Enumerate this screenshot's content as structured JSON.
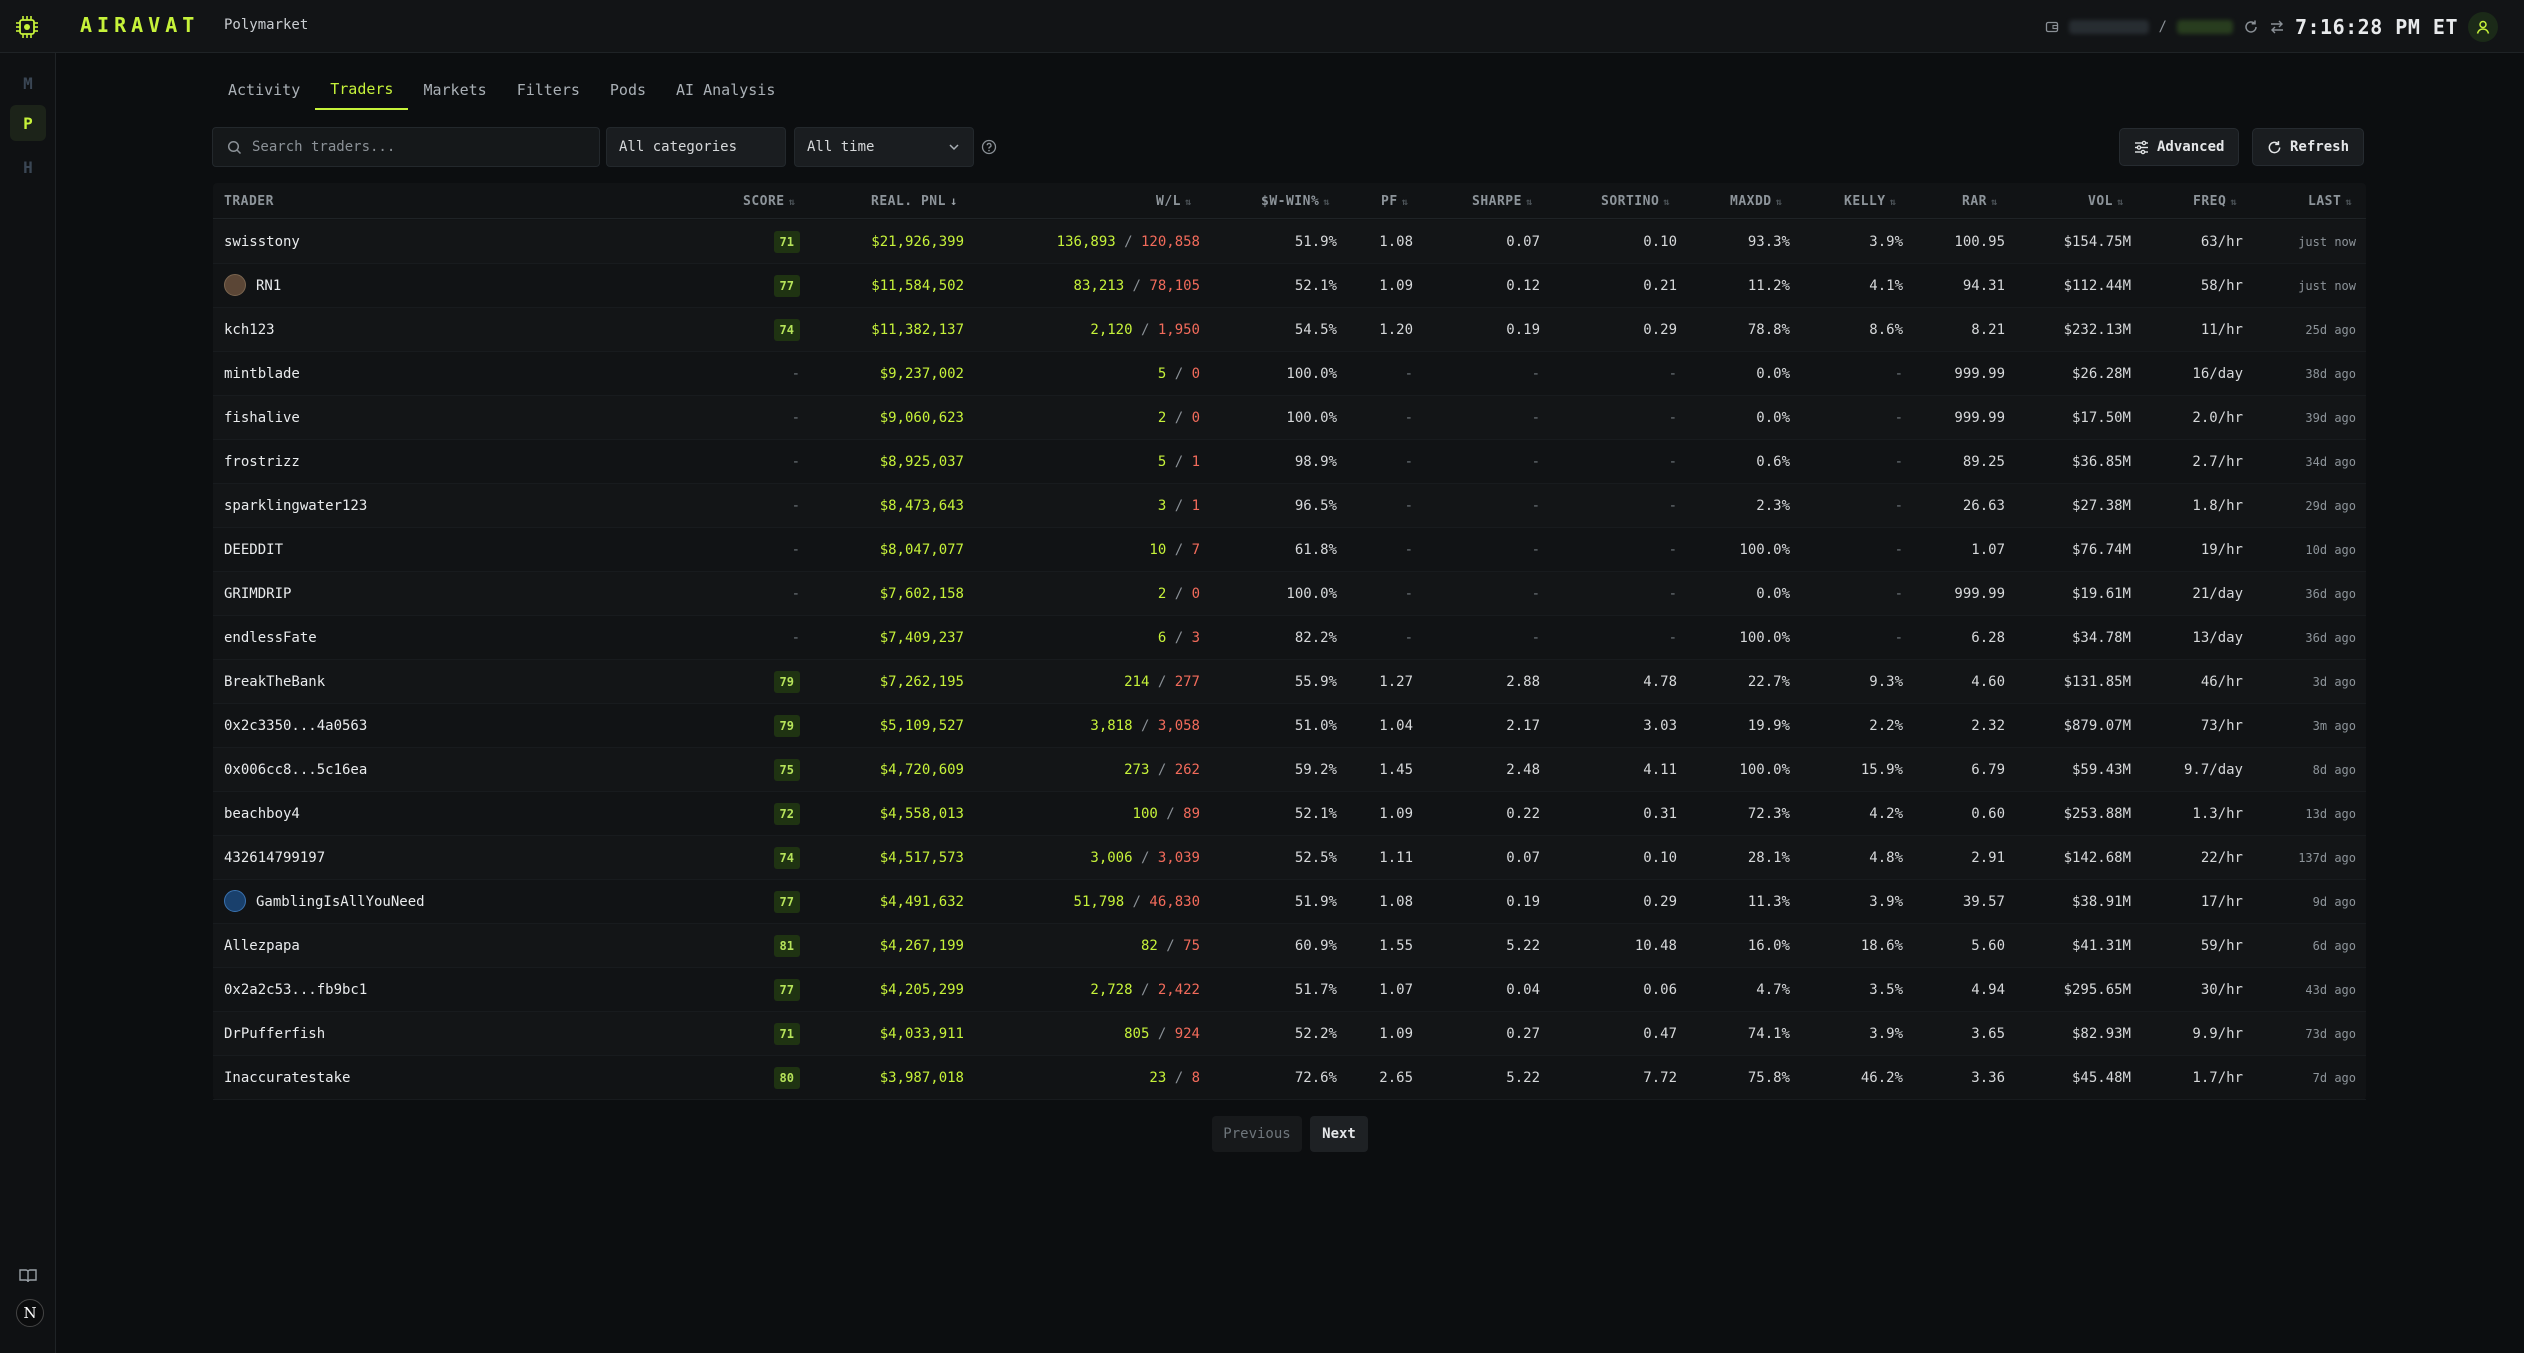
{
  "app": {
    "brand": "AIRAVAT",
    "platform": "Polymarket",
    "clock": "7:16:28 PM ET",
    "accent": "#c6f23a"
  },
  "sidebar": {
    "items": [
      "M",
      "P",
      "H"
    ],
    "active": "P",
    "footer_logo": "N"
  },
  "tabs": [
    {
      "label": "Activity"
    },
    {
      "label": "Traders",
      "active": true
    },
    {
      "label": "Markets"
    },
    {
      "label": "Filters"
    },
    {
      "label": "Pods"
    },
    {
      "label": "AI Analysis"
    }
  ],
  "filters": {
    "search_placeholder": "Search traders...",
    "category": "All categories",
    "timeframe": "All time",
    "advanced_label": "Advanced",
    "refresh_label": "Refresh"
  },
  "table": {
    "columns": [
      "TRADER",
      "SCORE",
      "REAL. PNL",
      "W/L",
      "$W-WIN%",
      "PF",
      "SHARPE",
      "SORTINO",
      "MAXDD",
      "KELLY",
      "RAR",
      "VOL",
      "FREQ",
      "LAST"
    ],
    "sorted_by": "REAL. PNL",
    "rows": [
      {
        "trader": "swisstony",
        "score": "71",
        "pnl": "$21,926,399",
        "wins": "136,893",
        "losses": "120,858",
        "wwin": "51.9%",
        "pf": "1.08",
        "sharpe": "0.07",
        "sortino": "0.10",
        "maxdd": "93.3%",
        "kelly": "3.9%",
        "rar": "100.95",
        "vol": "$154.75M",
        "freq": "63/hr",
        "last": "just now"
      },
      {
        "trader": "RN1",
        "avatar": "brown",
        "score": "77",
        "pnl": "$11,584,502",
        "wins": "83,213",
        "losses": "78,105",
        "wwin": "52.1%",
        "pf": "1.09",
        "sharpe": "0.12",
        "sortino": "0.21",
        "maxdd": "11.2%",
        "kelly": "4.1%",
        "rar": "94.31",
        "vol": "$112.44M",
        "freq": "58/hr",
        "last": "just now"
      },
      {
        "trader": "kch123",
        "score": "74",
        "pnl": "$11,382,137",
        "wins": "2,120",
        "losses": "1,950",
        "wwin": "54.5%",
        "pf": "1.20",
        "sharpe": "0.19",
        "sortino": "0.29",
        "maxdd": "78.8%",
        "kelly": "8.6%",
        "rar": "8.21",
        "vol": "$232.13M",
        "freq": "11/hr",
        "last": "25d ago"
      },
      {
        "trader": "mintblade",
        "score": "-",
        "pnl": "$9,237,002",
        "wins": "5",
        "losses": "0",
        "wwin": "100.0%",
        "pf": "-",
        "sharpe": "-",
        "sortino": "-",
        "maxdd": "0.0%",
        "kelly": "-",
        "rar": "999.99",
        "vol": "$26.28M",
        "freq": "16/day",
        "last": "38d ago"
      },
      {
        "trader": "fishalive",
        "score": "-",
        "pnl": "$9,060,623",
        "wins": "2",
        "losses": "0",
        "wwin": "100.0%",
        "pf": "-",
        "sharpe": "-",
        "sortino": "-",
        "maxdd": "0.0%",
        "kelly": "-",
        "rar": "999.99",
        "vol": "$17.50M",
        "freq": "2.0/hr",
        "last": "39d ago"
      },
      {
        "trader": "frostrizz",
        "score": "-",
        "pnl": "$8,925,037",
        "wins": "5",
        "losses": "1",
        "wwin": "98.9%",
        "pf": "-",
        "sharpe": "-",
        "sortino": "-",
        "maxdd": "0.6%",
        "kelly": "-",
        "rar": "89.25",
        "vol": "$36.85M",
        "freq": "2.7/hr",
        "last": "34d ago"
      },
      {
        "trader": "sparklingwater123",
        "score": "-",
        "pnl": "$8,473,643",
        "wins": "3",
        "losses": "1",
        "wwin": "96.5%",
        "pf": "-",
        "sharpe": "-",
        "sortino": "-",
        "maxdd": "2.3%",
        "kelly": "-",
        "rar": "26.63",
        "vol": "$27.38M",
        "freq": "1.8/hr",
        "last": "29d ago"
      },
      {
        "trader": "DEEDDIT",
        "score": "-",
        "pnl": "$8,047,077",
        "wins": "10",
        "losses": "7",
        "wwin": "61.8%",
        "pf": "-",
        "sharpe": "-",
        "sortino": "-",
        "maxdd": "100.0%",
        "kelly": "-",
        "rar": "1.07",
        "vol": "$76.74M",
        "freq": "19/hr",
        "last": "10d ago"
      },
      {
        "trader": "GRIMDRIP",
        "score": "-",
        "pnl": "$7,602,158",
        "wins": "2",
        "losses": "0",
        "wwin": "100.0%",
        "pf": "-",
        "sharpe": "-",
        "sortino": "-",
        "maxdd": "0.0%",
        "kelly": "-",
        "rar": "999.99",
        "vol": "$19.61M",
        "freq": "21/day",
        "last": "36d ago"
      },
      {
        "trader": "endlessFate",
        "score": "-",
        "pnl": "$7,409,237",
        "wins": "6",
        "losses": "3",
        "wwin": "82.2%",
        "pf": "-",
        "sharpe": "-",
        "sortino": "-",
        "maxdd": "100.0%",
        "kelly": "-",
        "rar": "6.28",
        "vol": "$34.78M",
        "freq": "13/day",
        "last": "36d ago"
      },
      {
        "trader": "BreakTheBank",
        "score": "79",
        "pnl": "$7,262,195",
        "wins": "214",
        "losses": "277",
        "wwin": "55.9%",
        "pf": "1.27",
        "sharpe": "2.88",
        "sortino": "4.78",
        "maxdd": "22.7%",
        "kelly": "9.3%",
        "rar": "4.60",
        "vol": "$131.85M",
        "freq": "46/hr",
        "last": "3d ago"
      },
      {
        "trader": "0x2c3350...4a0563",
        "score": "79",
        "pnl": "$5,109,527",
        "wins": "3,818",
        "losses": "3,058",
        "wwin": "51.0%",
        "pf": "1.04",
        "sharpe": "2.17",
        "sortino": "3.03",
        "maxdd": "19.9%",
        "kelly": "2.2%",
        "rar": "2.32",
        "vol": "$879.07M",
        "freq": "73/hr",
        "last": "3m ago"
      },
      {
        "trader": "0x006cc8...5c16ea",
        "score": "75",
        "pnl": "$4,720,609",
        "wins": "273",
        "losses": "262",
        "wwin": "59.2%",
        "pf": "1.45",
        "sharpe": "2.48",
        "sortino": "4.11",
        "maxdd": "100.0%",
        "kelly": "15.9%",
        "rar": "6.79",
        "vol": "$59.43M",
        "freq": "9.7/day",
        "last": "8d ago"
      },
      {
        "trader": "beachboy4",
        "score": "72",
        "pnl": "$4,558,013",
        "wins": "100",
        "losses": "89",
        "wwin": "52.1%",
        "pf": "1.09",
        "sharpe": "0.22",
        "sortino": "0.31",
        "maxdd": "72.3%",
        "kelly": "4.2%",
        "rar": "0.60",
        "vol": "$253.88M",
        "freq": "1.3/hr",
        "last": "13d ago"
      },
      {
        "trader": "432614799197",
        "score": "74",
        "pnl": "$4,517,573",
        "wins": "3,006",
        "losses": "3,039",
        "wwin": "52.5%",
        "pf": "1.11",
        "sharpe": "0.07",
        "sortino": "0.10",
        "maxdd": "28.1%",
        "kelly": "4.8%",
        "rar": "2.91",
        "vol": "$142.68M",
        "freq": "22/hr",
        "last": "137d ago"
      },
      {
        "trader": "GamblingIsAllYouNeed",
        "avatar": "blue",
        "score": "77",
        "pnl": "$4,491,632",
        "wins": "51,798",
        "losses": "46,830",
        "wwin": "51.9%",
        "pf": "1.08",
        "sharpe": "0.19",
        "sortino": "0.29",
        "maxdd": "11.3%",
        "kelly": "3.9%",
        "rar": "39.57",
        "vol": "$38.91M",
        "freq": "17/hr",
        "last": "9d ago"
      },
      {
        "trader": "Allezpapa",
        "score": "81",
        "pnl": "$4,267,199",
        "wins": "82",
        "losses": "75",
        "wwin": "60.9%",
        "pf": "1.55",
        "sharpe": "5.22",
        "sortino": "10.48",
        "maxdd": "16.0%",
        "kelly": "18.6%",
        "rar": "5.60",
        "vol": "$41.31M",
        "freq": "59/hr",
        "last": "6d ago"
      },
      {
        "trader": "0x2a2c53...fb9bc1",
        "score": "77",
        "pnl": "$4,205,299",
        "wins": "2,728",
        "losses": "2,422",
        "wwin": "51.7%",
        "pf": "1.07",
        "sharpe": "0.04",
        "sortino": "0.06",
        "maxdd": "4.7%",
        "kelly": "3.5%",
        "rar": "4.94",
        "vol": "$295.65M",
        "freq": "30/hr",
        "last": "43d ago"
      },
      {
        "trader": "DrPufferfish",
        "score": "71",
        "pnl": "$4,033,911",
        "wins": "805",
        "losses": "924",
        "wwin": "52.2%",
        "pf": "1.09",
        "sharpe": "0.27",
        "sortino": "0.47",
        "maxdd": "74.1%",
        "kelly": "3.9%",
        "rar": "3.65",
        "vol": "$82.93M",
        "freq": "9.9/hr",
        "last": "73d ago"
      },
      {
        "trader": "Inaccuratestake",
        "score": "80",
        "pnl": "$3,987,018",
        "wins": "23",
        "losses": "8",
        "wwin": "72.6%",
        "pf": "2.65",
        "sharpe": "5.22",
        "sortino": "7.72",
        "maxdd": "75.8%",
        "kelly": "46.2%",
        "rar": "3.36",
        "vol": "$45.48M",
        "freq": "1.7/hr",
        "last": "7d ago"
      }
    ]
  },
  "pagination": {
    "previous_label": "Previous",
    "next_label": "Next"
  },
  "colors": {
    "win": "#c6f23a",
    "loss": "#f26b5b",
    "score_bg": "#1f3312"
  }
}
